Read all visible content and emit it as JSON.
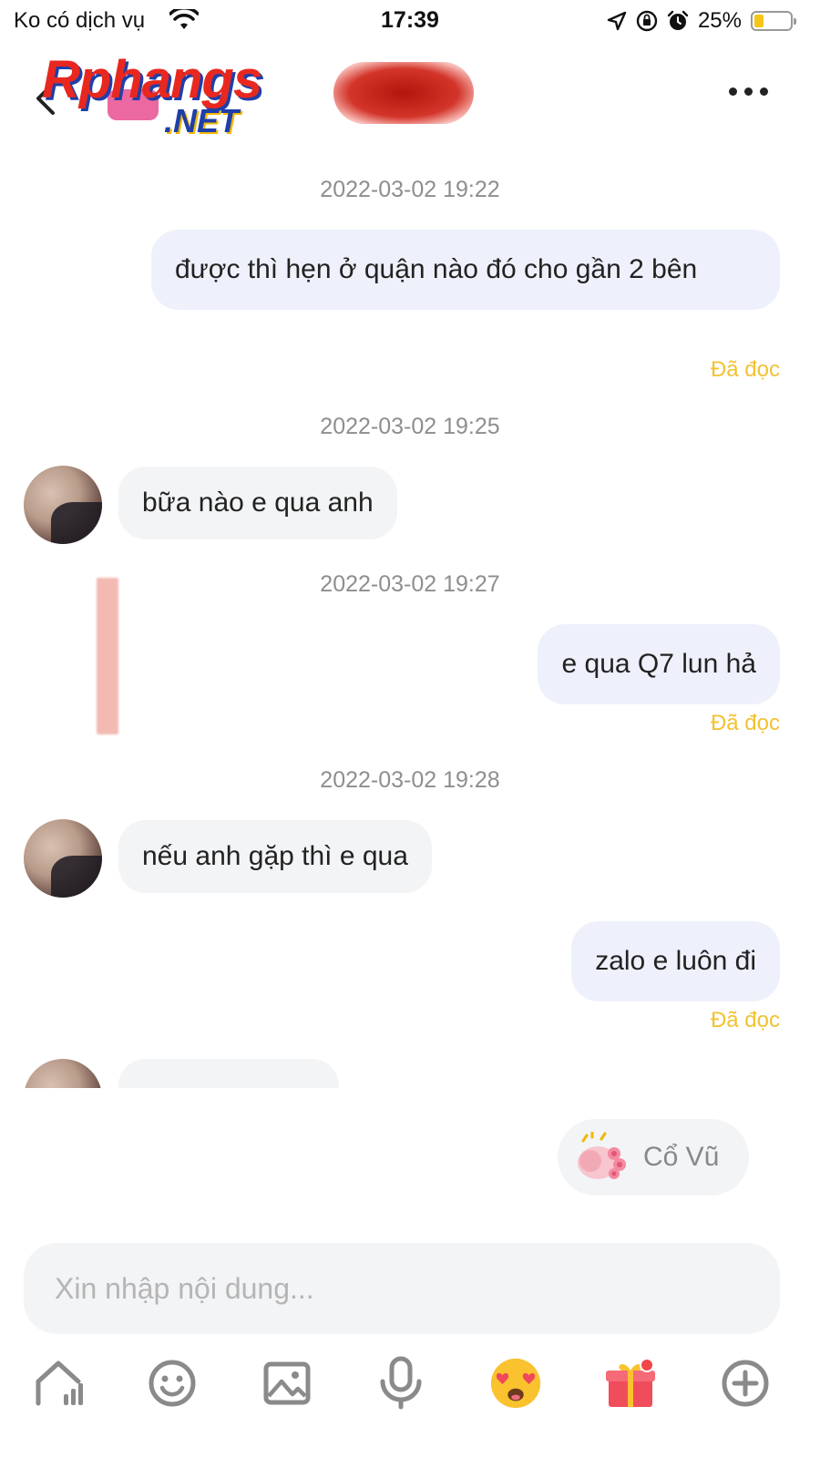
{
  "status_bar": {
    "carrier": "Ko có dịch vụ",
    "time": "17:39",
    "battery_percent": "25%",
    "battery_level": 0.25,
    "icons": [
      "wifi-icon",
      "location-arrow-icon",
      "rotation-lock-icon",
      "alarm-icon",
      "battery-icon"
    ]
  },
  "header": {
    "logo_main": "Rphangs",
    "logo_sub": ".NET",
    "contact_name": "",
    "icons": [
      "back-icon",
      "more-icon"
    ]
  },
  "messages": [
    {
      "type": "timestamp",
      "text": "2022-03-02 19:22"
    },
    {
      "type": "outgoing",
      "text": "được thì hẹn ở quận nào đó cho gần 2 bên",
      "status": "Đã đọc"
    },
    {
      "type": "timestamp",
      "text": "2022-03-02 19:25"
    },
    {
      "type": "incoming",
      "text": "bữa nào e qua anh"
    },
    {
      "type": "timestamp",
      "text": "2022-03-02 19:27"
    },
    {
      "type": "outgoing",
      "text": "e qua Q7 lun hả",
      "status": "Đã đọc"
    },
    {
      "type": "timestamp",
      "text": "2022-03-02 19:28"
    },
    {
      "type": "incoming",
      "text": "nếu anh gặp thì e qua"
    },
    {
      "type": "outgoing",
      "text": "zalo e luôn đi",
      "status": "Đã đọc"
    },
    {
      "type": "incoming",
      "text": ""
    }
  ],
  "cheer_button": {
    "label": "Cổ Vũ"
  },
  "composer": {
    "placeholder": "Xin nhập nội dung..."
  },
  "toolbar": {
    "items": [
      "stats-icon",
      "emoji-icon",
      "image-icon",
      "microphone-icon",
      "heart-eyes-emoji-icon",
      "gift-icon",
      "plus-icon"
    ],
    "accent_color": "#f1c232"
  }
}
